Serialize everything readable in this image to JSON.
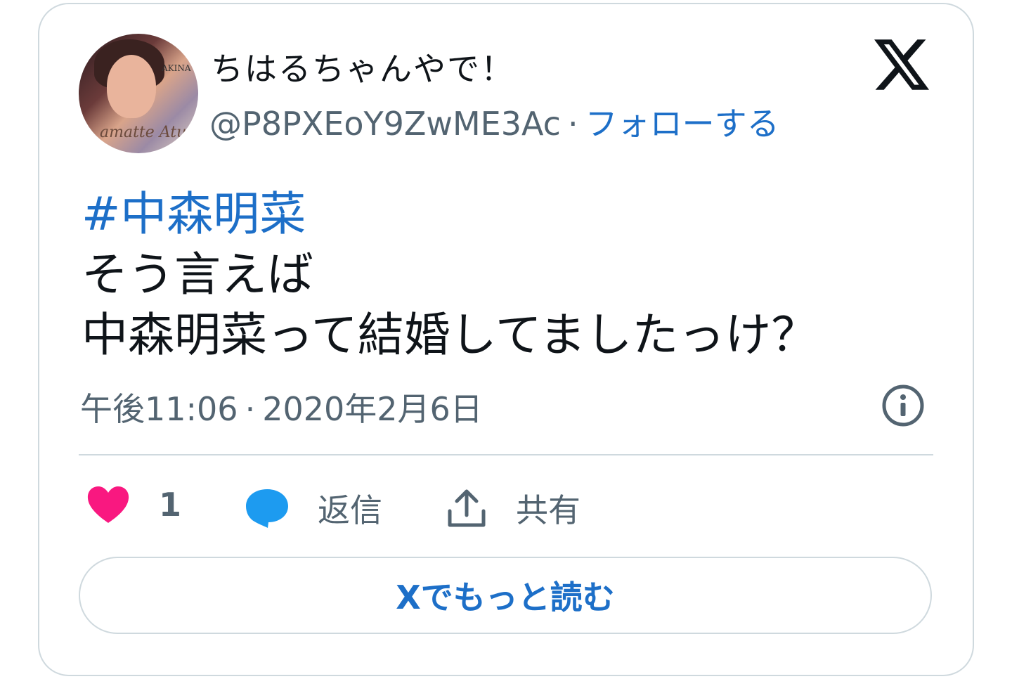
{
  "author": {
    "display_name": "ちはるちゃんやで！",
    "handle": "@P8PXEoY9ZwME3Ac",
    "separator": "·",
    "follow_label": "フォローする",
    "avatar_text": "AKINA",
    "avatar_script": "amatte Atu"
  },
  "tweet": {
    "hashtag": "#中森明菜",
    "line1": "そう言えば",
    "line2": "中森明菜って結婚してましたっけ？"
  },
  "meta": {
    "time": "午後11:06",
    "separator": "·",
    "date": "2020年2月6日"
  },
  "actions": {
    "like_count": "1",
    "reply_label": "返信",
    "share_label": "共有"
  },
  "read_more_label": "Xでもっと読む",
  "colors": {
    "link": "#1d6fc8",
    "like": "#f91880",
    "reply": "#1d9bf0",
    "muted": "#536471",
    "border": "#cfd9de"
  },
  "icons": {
    "logo": "x-logo-icon",
    "info": "info-icon",
    "like": "heart-icon",
    "reply": "speech-bubble-icon",
    "share": "share-upload-icon"
  }
}
